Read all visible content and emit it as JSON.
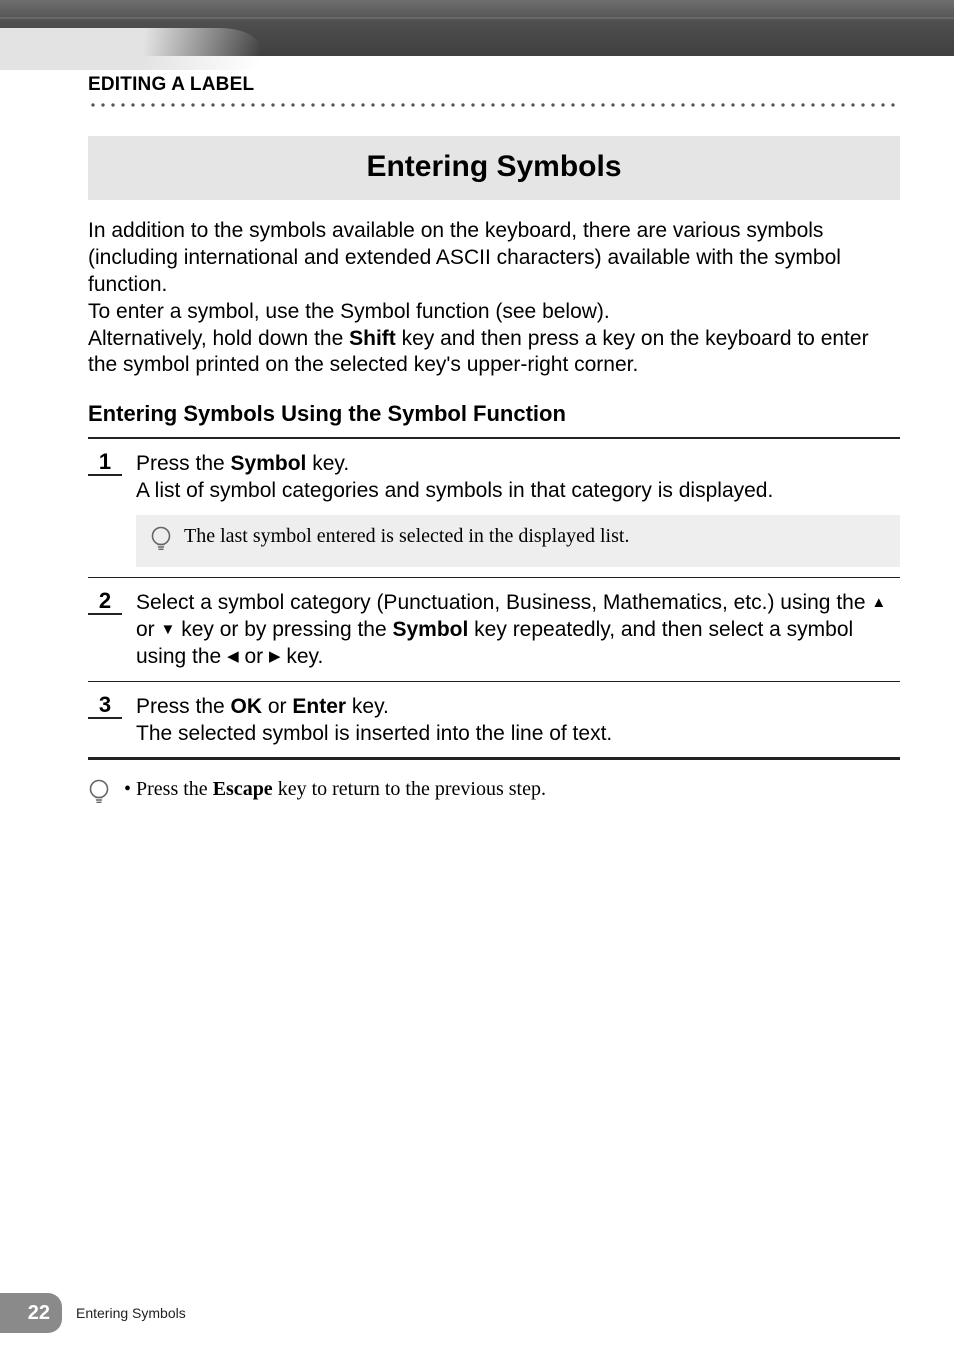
{
  "chapter": "EDITING A LABEL",
  "title": "Entering Symbols",
  "intro": {
    "p1": "In addition to the symbols available on the keyboard, there are various symbols (including international and extended ASCII characters) available with the symbol function.",
    "p2": "To enter a symbol, use the Symbol function (see below).",
    "p3a": "Alternatively, hold down the ",
    "p3_bold": "Shift",
    "p3b": " key and then press a key on the keyboard to enter the symbol printed on the selected key's upper-right corner."
  },
  "subhead": "Entering Symbols Using the Symbol Function",
  "steps": [
    {
      "num": "1",
      "segments": [
        {
          "t": "Press the "
        },
        {
          "t": "Symbol",
          "b": true
        },
        {
          "t": " key."
        },
        {
          "br": true
        },
        {
          "t": "A list of symbol categories and symbols in that category is displayed."
        }
      ],
      "note": "The last symbol entered is selected in the displayed list.",
      "rule_after": "thin"
    },
    {
      "num": "2",
      "segments": [
        {
          "t": "Select a symbol category (Punctuation, Business, Mathematics, etc.) using the "
        },
        {
          "tri": "up"
        },
        {
          "t": " or "
        },
        {
          "tri": "down"
        },
        {
          "t": " key or by pressing the "
        },
        {
          "t": "Symbol",
          "b": true
        },
        {
          "t": " key repeatedly, and then select a symbol using the "
        },
        {
          "tri": "left"
        },
        {
          "t": " or "
        },
        {
          "tri": "right"
        },
        {
          "t": " key."
        }
      ],
      "rule_after": "thin"
    },
    {
      "num": "3",
      "segments": [
        {
          "t": "Press the "
        },
        {
          "t": "OK",
          "b": true
        },
        {
          "t": " or "
        },
        {
          "t": "Enter",
          "b": true
        },
        {
          "t": " key."
        },
        {
          "br": true
        },
        {
          "t": "The selected symbol is inserted into the line of text."
        }
      ],
      "rule_after": "heavy"
    }
  ],
  "footer_note": {
    "bullet": "•",
    "pre": "Press the ",
    "bold": "Escape",
    "post": " key to return to the previous step."
  },
  "footer": {
    "page_num": "22",
    "section": "Entering Symbols"
  },
  "triangles": {
    "up": "▲",
    "down": "▼",
    "left": "◀",
    "right": "▶"
  }
}
